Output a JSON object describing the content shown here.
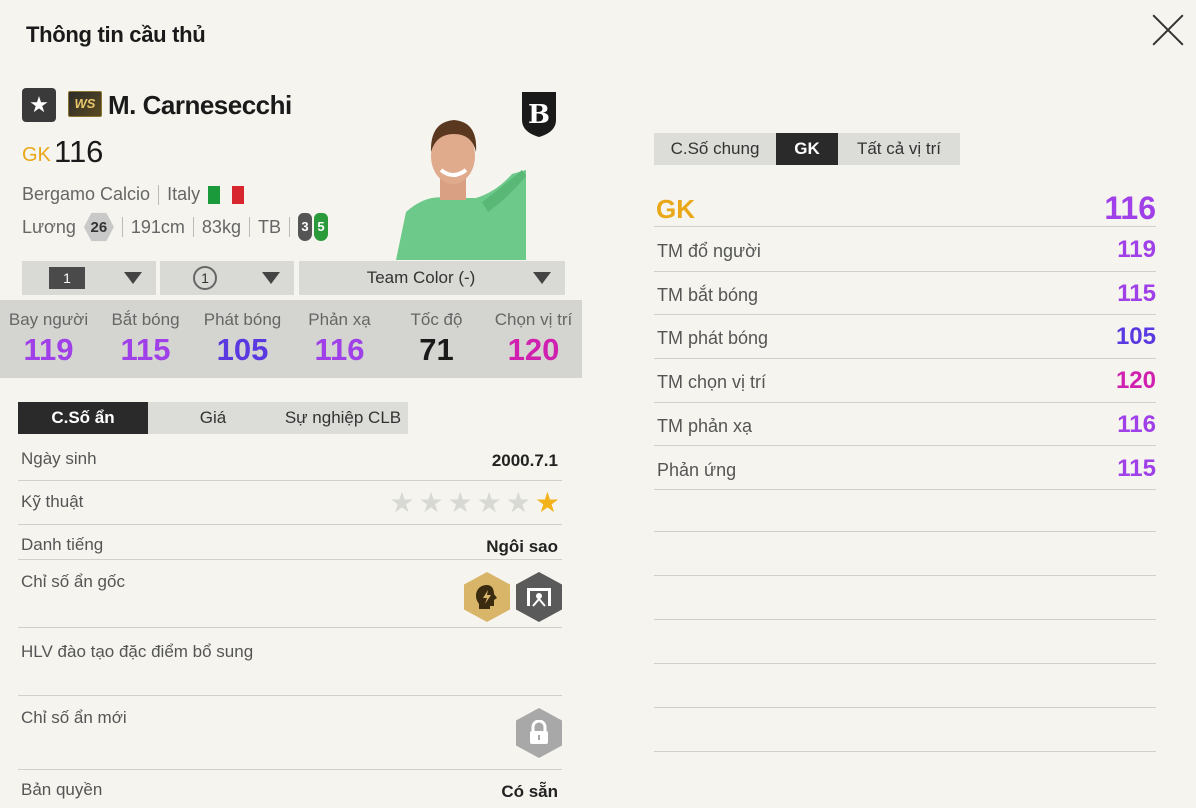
{
  "header": {
    "title": "Thông tin cầu thủ"
  },
  "player": {
    "name": "M. Carnesecchi",
    "season_badge": "WS",
    "position": "GK",
    "ovr": "116",
    "club": "Bergamo Calcio",
    "nation": "Italy",
    "salary_label": "Lương",
    "salary": "26",
    "height": "191cm",
    "weight": "83kg",
    "body_type": "TB",
    "left_foot": "3",
    "right_foot": "5"
  },
  "selectors": {
    "level": "1",
    "training": "1",
    "team_color": "Team Color (-)"
  },
  "main_stats": [
    {
      "label": "Bay người",
      "value": "119",
      "color": "#a040e8"
    },
    {
      "label": "Bắt bóng",
      "value": "115",
      "color": "#a040e8"
    },
    {
      "label": "Phát bóng",
      "value": "105",
      "color": "#5a3ae0"
    },
    {
      "label": "Phản xạ",
      "value": "116",
      "color": "#a040e8"
    },
    {
      "label": "Tốc độ",
      "value": "71",
      "color": "#1a1a1a"
    },
    {
      "label": "Chọn vị trí",
      "value": "120",
      "color": "#d020b0"
    }
  ],
  "left_tabs": [
    "C.Số ẩn",
    "Giá",
    "Sự nghiệp CLB"
  ],
  "details": {
    "birthday_label": "Ngày sinh",
    "birthday": "2000.7.1",
    "skill_label": "Kỹ thuật",
    "skill_stars": 1,
    "fame_label": "Danh tiếng",
    "fame": "Ngôi sao",
    "hidden_base_label": "Chỉ số ẩn gốc",
    "coach_label": "HLV đào tạo đặc điểm bổ sung",
    "new_hidden_label": "Chỉ số ẩn mới",
    "license_label": "Bản quyền",
    "license": "Có sẵn"
  },
  "right_tabs": [
    "C.Số chung",
    "GK",
    "Tất cả vị trí"
  ],
  "right_panel": {
    "title": "GK",
    "title_value": "116",
    "rows": [
      {
        "label": "TM đổ người",
        "value": "119",
        "color": "#a040e8"
      },
      {
        "label": "TM bắt bóng",
        "value": "115",
        "color": "#a040e8"
      },
      {
        "label": "TM phát bóng",
        "value": "105",
        "color": "#5a3ae0"
      },
      {
        "label": "TM chọn vị trí",
        "value": "120",
        "color": "#d020b0"
      },
      {
        "label": "TM phản xạ",
        "value": "116",
        "color": "#a040e8"
      },
      {
        "label": "Phản ứng",
        "value": "115",
        "color": "#a040e8"
      }
    ]
  },
  "colors": {
    "accent_gold": "#e8a81a",
    "dark_tab": "#2a2a2a"
  },
  "icons": [
    "close-icon",
    "star-icon",
    "club-crest-icon",
    "flag-italy-icon",
    "lightning-head-icon",
    "goalkeeper-dive-icon",
    "lock-icon",
    "dropdown-arrow-icon"
  ]
}
